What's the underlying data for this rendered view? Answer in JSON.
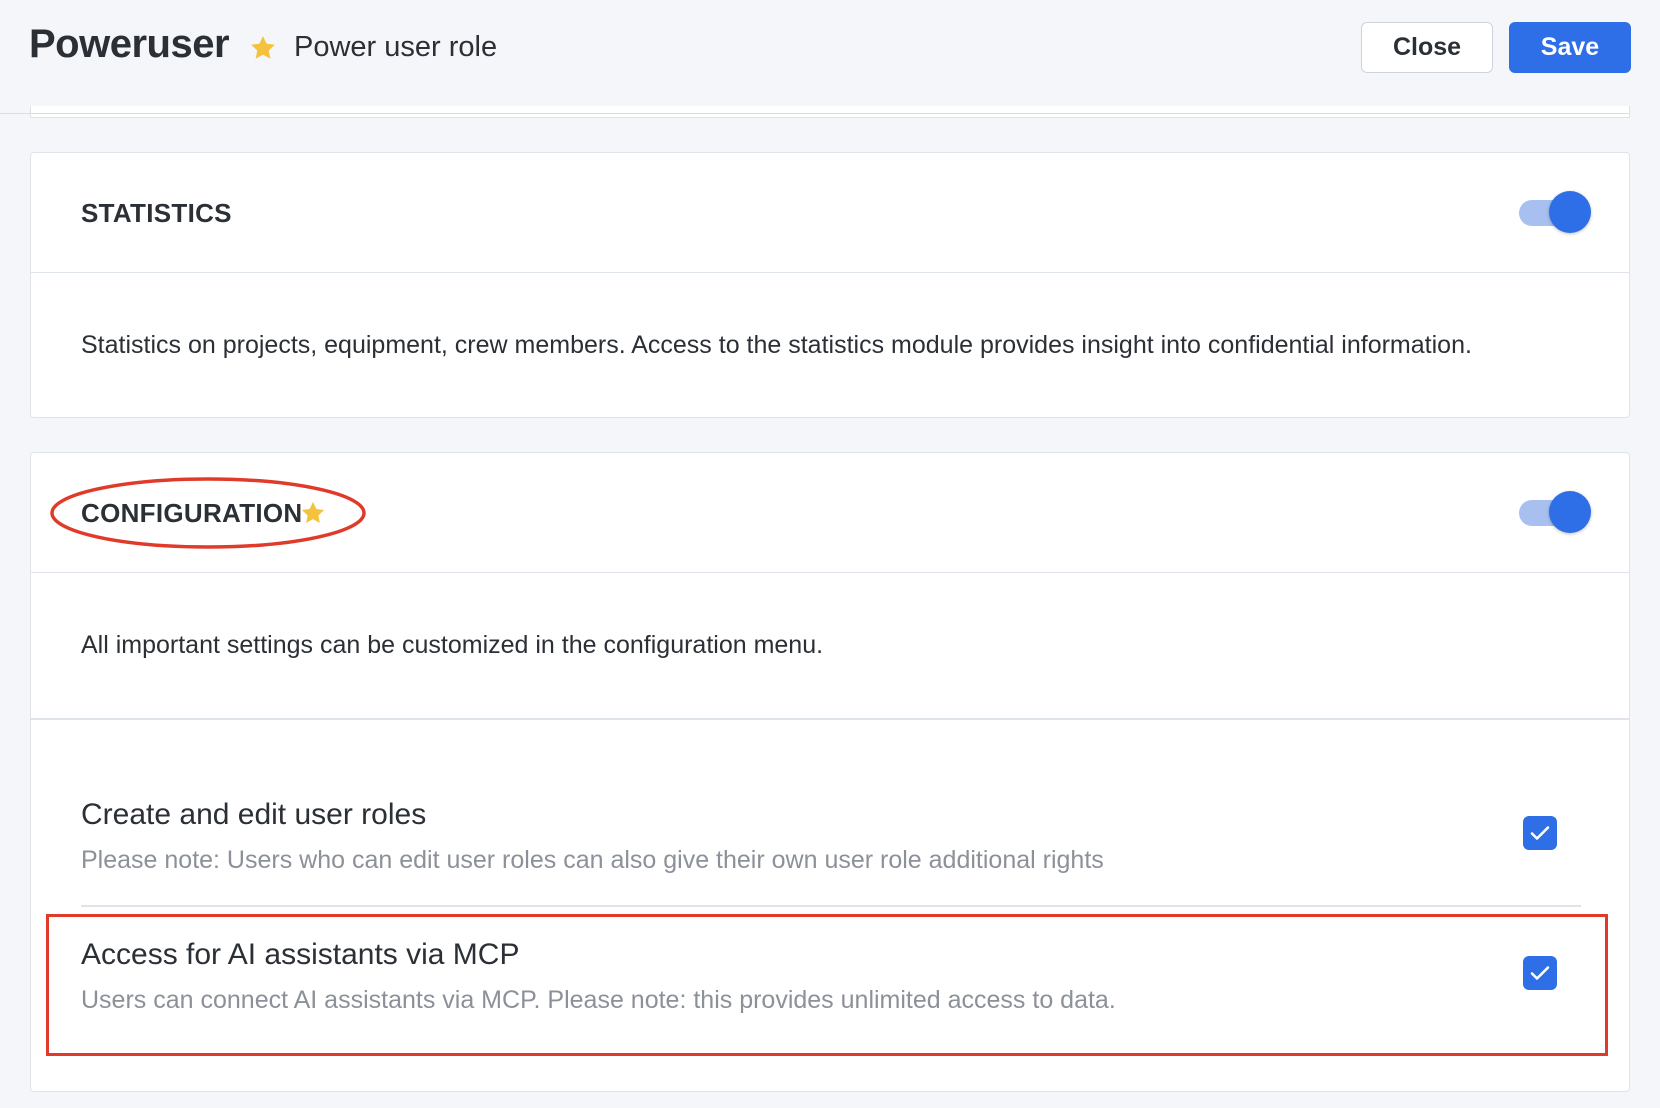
{
  "header": {
    "title": "Poweruser",
    "subtitle": "Power user role",
    "close_label": "Close",
    "save_label": "Save"
  },
  "sections": {
    "statistics": {
      "title": "STATISTICS",
      "enabled": true,
      "description": "Statistics on projects, equipment, crew members. Access to the statistics module provides insight into confidential information."
    },
    "configuration": {
      "title": "CONFIGURATION",
      "enabled": true,
      "description": "All important settings can be customized in the configuration menu.",
      "permissions": [
        {
          "title": "Create and edit user roles",
          "note": "Please note: Users who can edit user roles can also give their own user role additional rights",
          "checked": true
        },
        {
          "title": "Access for AI assistants via MCP",
          "note": "Users can connect AI assistants via MCP. Please note: this provides unlimited access to data.",
          "checked": true
        }
      ]
    }
  },
  "colors": {
    "accent": "#2e6ee6",
    "star": "#f5c23e",
    "annotation": "#e03b2a"
  }
}
